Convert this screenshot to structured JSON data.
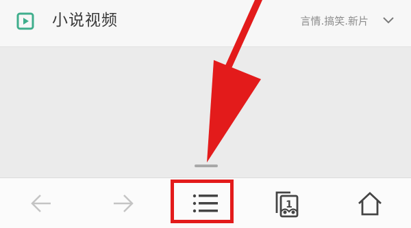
{
  "header": {
    "title": "小说视频",
    "tags": "言情.搞笑.新片",
    "icon": "play-icon",
    "expand_icon": "chevron-down-icon"
  },
  "toolbar": {
    "buttons": [
      {
        "name": "back",
        "icon": "back-arrow-icon"
      },
      {
        "name": "forward",
        "icon": "forward-arrow-icon"
      },
      {
        "name": "menu",
        "icon": "menu-list-icon"
      },
      {
        "name": "tabs",
        "icon": "tabs-icon",
        "count": "1"
      },
      {
        "name": "home",
        "icon": "home-icon"
      }
    ]
  },
  "colors": {
    "accent_green": "#3fae8c",
    "annotation_red": "#e31b1b",
    "icon_gray": "#444444",
    "disabled_gray": "#c4c4c4"
  }
}
